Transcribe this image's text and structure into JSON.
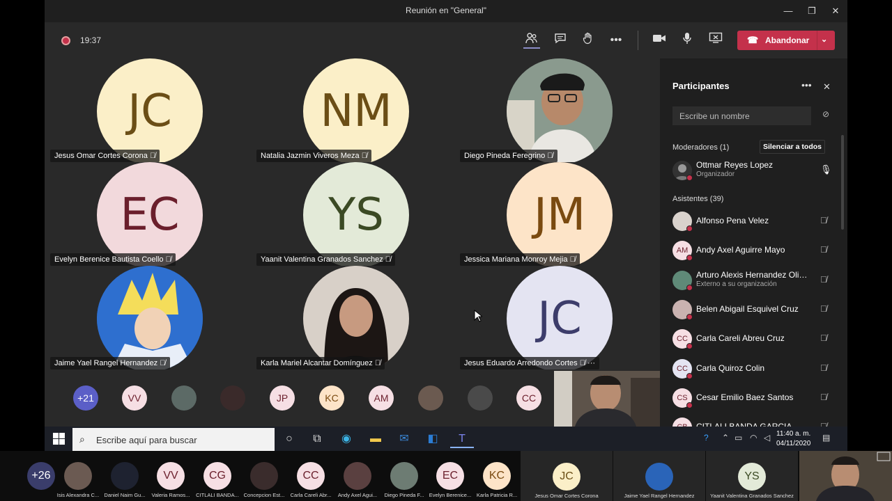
{
  "window": {
    "title": "Reunión en \"General\"",
    "min": "—",
    "max": "❐",
    "close": "✕"
  },
  "toolbar": {
    "timer": "19:37",
    "leave_label": "Abandonar",
    "icons": [
      "participants-icon",
      "chat-icon",
      "raise-hand-icon",
      "more-icon",
      "camera-icon",
      "mic-icon",
      "share-icon"
    ]
  },
  "stage": {
    "tiles": [
      {
        "initials": "JC",
        "name": "Jesus Omar Cortes Corona",
        "bg": "#fbefc8",
        "fg": "#6b4e16"
      },
      {
        "initials": "NM",
        "name": "Natalia Jazmin Viveros Meza",
        "bg": "#fbefc8",
        "fg": "#6b4e16"
      },
      {
        "initials": "",
        "name": "Diego Pineda Feregrino",
        "bg": "#6d7c73",
        "fg": "#fff"
      },
      {
        "initials": "EC",
        "name": "Evelyn Berenice Bautista Coello",
        "bg": "#f2d9dc",
        "fg": "#6b1f2c"
      },
      {
        "initials": "YS",
        "name": "Yaanit Valentina Granados Sanchez",
        "bg": "#e3ead8",
        "fg": "#3b4a24"
      },
      {
        "initials": "JM",
        "name": "Jessica Mariana Monroy Mejia",
        "bg": "#fde4c8",
        "fg": "#7a4a10"
      },
      {
        "initials": "",
        "name": "Jaime Yael Rangel Hernandez",
        "bg": "#2a64b8",
        "fg": "#fff"
      },
      {
        "initials": "",
        "name": "Karla Mariel Alcantar Domínguez",
        "bg": "#5a5048",
        "fg": "#fff"
      },
      {
        "initials": "JC",
        "name": "Jesus Eduardo Arredondo Cortes",
        "bg": "#e4e4f2",
        "fg": "#3d3d6b"
      }
    ],
    "strip": [
      {
        "text": "+21",
        "bg": "#5b5fc7",
        "fg": "#fff"
      },
      {
        "text": "VV",
        "bg": "#f6dfe4",
        "fg": "#6b1f2c"
      },
      {
        "text": "",
        "bg": "#5c6a66",
        "fg": "#fff"
      },
      {
        "text": "",
        "bg": "#3a2a2a",
        "fg": "#fff"
      },
      {
        "text": "JP",
        "bg": "#f6dfe4",
        "fg": "#6b1f2c"
      },
      {
        "text": "KC",
        "bg": "#fde4c8",
        "fg": "#7a4a10"
      },
      {
        "text": "AM",
        "bg": "#f6dfe4",
        "fg": "#6b1f2c"
      },
      {
        "text": "",
        "bg": "#6b5a50",
        "fg": "#fff"
      },
      {
        "text": "",
        "bg": "#4a4a4a",
        "fg": "#fff"
      },
      {
        "text": "CC",
        "bg": "#f6dfe4",
        "fg": "#6b1f2c"
      }
    ]
  },
  "panel": {
    "title": "Participantes",
    "more": "•••",
    "close": "✕",
    "search_placeholder": "Escribe un nombre",
    "moderators_label": "Moderadores (1)",
    "mute_all": "Silenciar a todos",
    "moderator": {
      "name": "Ottmar Reyes Lopez",
      "role": "Organizador"
    },
    "attendees_label": "Asistentes (39)",
    "attendees": [
      {
        "initials": "",
        "name": "Alfonso Pena Velez",
        "sub": "",
        "bg": "#d9d2cc"
      },
      {
        "initials": "AM",
        "name": "Andy Axel Aguirre Mayo",
        "sub": "",
        "bg": "#f6dfe4"
      },
      {
        "initials": "",
        "name": "Arturo Alexis Hernandez Oliv...",
        "sub": "Externo a su organización",
        "bg": "#5f8a78"
      },
      {
        "initials": "",
        "name": "Belen Abigail Esquivel Cruz",
        "sub": "",
        "bg": "#c9b2b0"
      },
      {
        "initials": "CC",
        "name": "Carla Careli Abreu Cruz",
        "sub": "",
        "bg": "#f6dfe4"
      },
      {
        "initials": "CC",
        "name": "Carla Quiroz Colin",
        "sub": "",
        "bg": "#e4e4f2"
      },
      {
        "initials": "CS",
        "name": "Cesar Emilio Baez Santos",
        "sub": "",
        "bg": "#f6dfe4"
      },
      {
        "initials": "CB",
        "name": "CITLALI BANDA GARCIA",
        "sub": "",
        "bg": "#f6dfe4"
      }
    ]
  },
  "taskbar": {
    "search_placeholder": "Escribe aquí para buscar",
    "time": "11:40 a. m.",
    "date": "04/11/2020"
  },
  "gallery": {
    "small": [
      {
        "text": "+26",
        "name": "",
        "bg": "#3a3d6b",
        "fg": "#fff"
      },
      {
        "text": "",
        "name": "Isis Alexandra C...",
        "bg": "#6b5a52",
        "fg": "#fff"
      },
      {
        "text": "",
        "name": "Daniel Naim Gu...",
        "bg": "#1e2230",
        "fg": "#fff"
      },
      {
        "text": "VV",
        "name": "Valeria Ramos...",
        "bg": "#f6dfe4",
        "fg": "#6b1f2c"
      },
      {
        "text": "CG",
        "name": "CITLALI BANDA...",
        "bg": "#f6dfe4",
        "fg": "#6b1f2c"
      },
      {
        "text": "",
        "name": "Concepcion Est...",
        "bg": "#3a2c2c",
        "fg": "#fff"
      },
      {
        "text": "CC",
        "name": "Carla Careli Abr...",
        "bg": "#f6dfe4",
        "fg": "#6b1f2c"
      },
      {
        "text": "",
        "name": "Andy Axel Agui...",
        "bg": "#5a4040",
        "fg": "#fff"
      },
      {
        "text": "",
        "name": "Diego Pineda F...",
        "bg": "#6d7c73",
        "fg": "#fff"
      },
      {
        "text": "EC",
        "name": "Evelyn Berenice...",
        "bg": "#f6dfe4",
        "fg": "#6b1f2c"
      },
      {
        "text": "KC",
        "name": "Karla Patricia R...",
        "bg": "#fde4c8",
        "fg": "#7a4a10"
      }
    ],
    "big": [
      {
        "text": "JC",
        "name": "Jesus Omar Cortes Corona",
        "bg": "#fbefc8",
        "fg": "#6b4e16"
      },
      {
        "text": "",
        "name": "Jaime Yael Rangel Hernandez",
        "bg": "#2a64b8",
        "fg": "#fff"
      },
      {
        "text": "YS",
        "name": "Yaanit Valentina Granados Sanchez",
        "bg": "#e3ead8",
        "fg": "#3b4a24"
      }
    ]
  }
}
